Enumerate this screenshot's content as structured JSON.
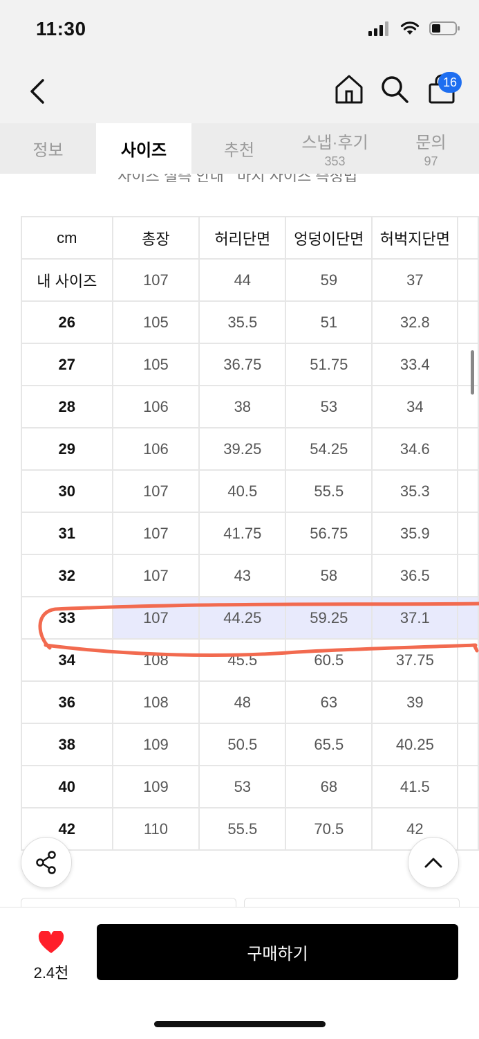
{
  "status_bar": {
    "time": "11:30"
  },
  "nav": {
    "cart_count": "16"
  },
  "tabs": [
    {
      "label": "정보",
      "sub": ""
    },
    {
      "label": "사이즈",
      "sub": ""
    },
    {
      "label": "추천",
      "sub": ""
    },
    {
      "label": "스냅·후기",
      "sub": "353"
    },
    {
      "label": "문의",
      "sub": "97"
    }
  ],
  "active_tab": "사이즈",
  "size_links": [
    "사이즈 실측 안내",
    "마지 사이즈 측정법"
  ],
  "size_table": {
    "headers": [
      "cm",
      "총장",
      "허리단면",
      "엉덩이단면",
      "허벅지단면"
    ],
    "rows": [
      [
        "내 사이즈",
        "107",
        "44",
        "59",
        "37"
      ],
      [
        "26",
        "105",
        "35.5",
        "51",
        "32.8"
      ],
      [
        "27",
        "105",
        "36.75",
        "51.75",
        "33.4"
      ],
      [
        "28",
        "106",
        "38",
        "53",
        "34"
      ],
      [
        "29",
        "106",
        "39.25",
        "54.25",
        "34.6"
      ],
      [
        "30",
        "107",
        "40.5",
        "55.5",
        "35.3"
      ],
      [
        "31",
        "107",
        "41.75",
        "56.75",
        "35.9"
      ],
      [
        "32",
        "107",
        "43",
        "58",
        "36.5"
      ],
      [
        "33",
        "107",
        "44.25",
        "59.25",
        "37.1"
      ],
      [
        "34",
        "108",
        "45.5",
        "60.5",
        "37.75"
      ],
      [
        "36",
        "108",
        "48",
        "63",
        "39"
      ],
      [
        "38",
        "109",
        "50.5",
        "65.5",
        "40.25"
      ],
      [
        "40",
        "109",
        "53",
        "68",
        "41.5"
      ],
      [
        "42",
        "110",
        "55.5",
        "70.5",
        "42"
      ]
    ],
    "highlighted_size": "33"
  },
  "bottom_bar": {
    "like_count": "2.4천",
    "buy_label": "구매하기"
  },
  "colors": {
    "accent": "#1e6ef0",
    "like": "#ff1f2a",
    "highlight_row": "#e8eafc",
    "annotation": "#f26a4f"
  }
}
